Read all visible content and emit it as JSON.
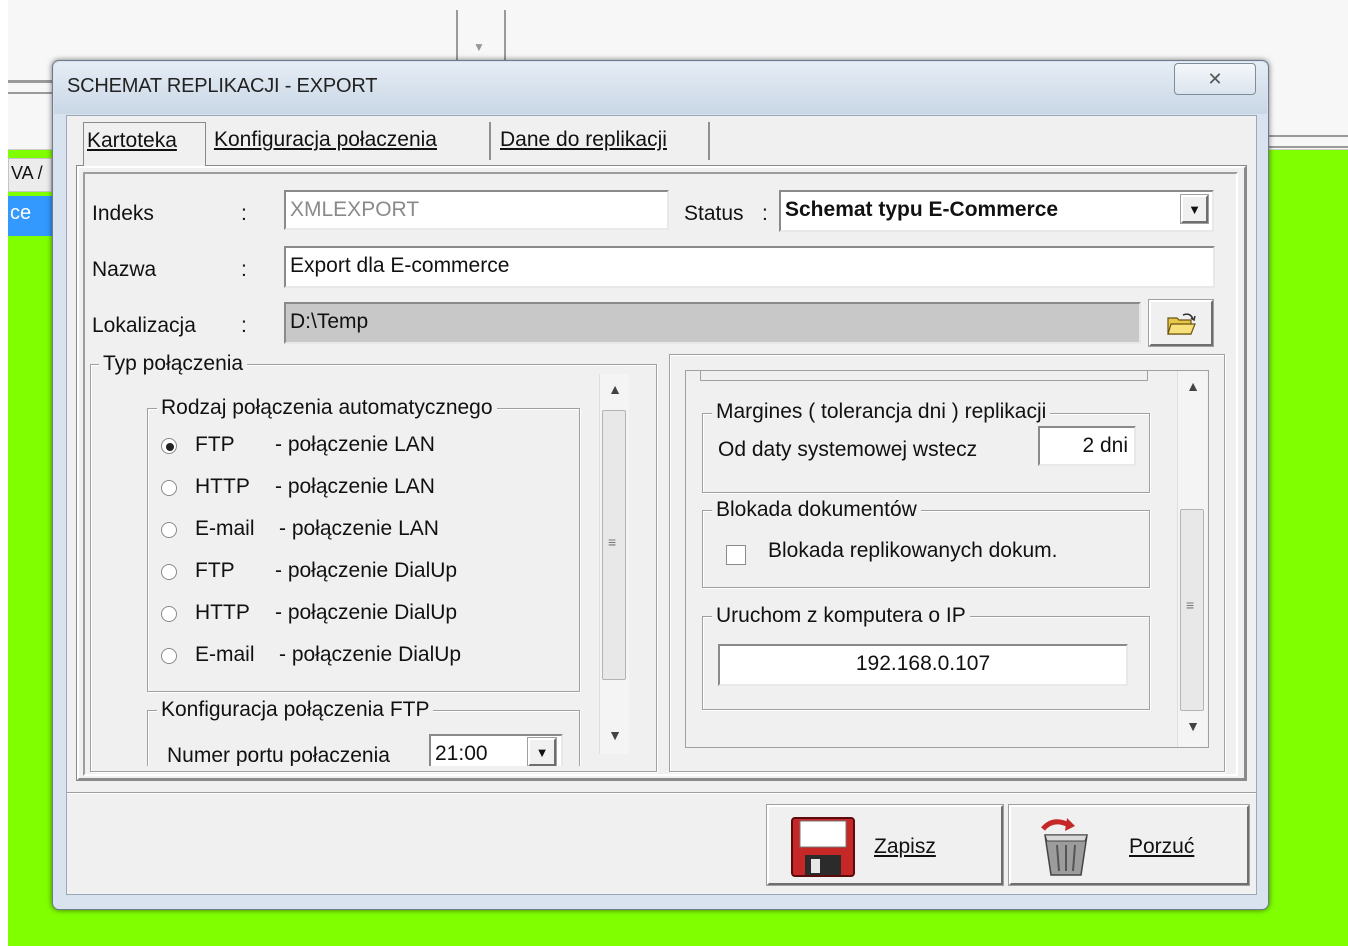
{
  "background": {
    "column_label": "VA /",
    "selected_cell": "ce",
    "accent_color": "#80ff00"
  },
  "dialog": {
    "title": "SCHEMAT REPLIKACJI - EXPORT",
    "close_icon": "close-icon",
    "tabs": [
      {
        "label": "Kartoteka",
        "active": true
      },
      {
        "label": "Konfiguracja połaczenia",
        "active": false
      },
      {
        "label": "Dane do replikacji",
        "active": false
      }
    ],
    "fields": {
      "indeks_label": "Indeks",
      "indeks_sep": ":",
      "indeks_value": "XMLEXPORT",
      "status_label": "Status",
      "status_sep": ":",
      "status_value": "Schemat typu E-Commerce",
      "nazwa_label": "Nazwa",
      "nazwa_sep": ":",
      "nazwa_value": "Export dla E-commerce",
      "lokalizacja_label": "Lokalizacja",
      "lokalizacja_sep": ":",
      "lokalizacja_value": "D:\\Temp"
    },
    "typ_polaczenia": {
      "title": "Typ połączenia",
      "rodzaj": {
        "title": "Rodzaj połączenia automatycznego",
        "options": [
          {
            "proto": "FTP",
            "desc": "- połączenie LAN",
            "selected": true
          },
          {
            "proto": "HTTP",
            "desc": "- połączenie LAN",
            "selected": false
          },
          {
            "proto": "E-mail",
            "desc": "- połączenie LAN",
            "selected": false
          },
          {
            "proto": "FTP",
            "desc": "- połączenie DialUp",
            "selected": false
          },
          {
            "proto": "HTTP",
            "desc": "- połączenie DialUp",
            "selected": false
          },
          {
            "proto": "E-mail",
            "desc": "- połączenie DialUp",
            "selected": false
          }
        ]
      },
      "ftp": {
        "title": "Konfiguracja połączenia FTP",
        "port_label": "Numer portu połaczenia",
        "port_value": "21:00"
      }
    },
    "right_panel": {
      "margines": {
        "title": "Margines ( tolerancja dni ) replikacji",
        "label": "Od daty systemowej  wstecz",
        "value": "2 dni"
      },
      "blokada": {
        "title": "Blokada dokumentów",
        "checkbox_label": "Blokada replikowanych dokum.",
        "checked": false
      },
      "uruchom": {
        "title": "Uruchom z komputera o IP",
        "ip": "192.168.0.107"
      }
    },
    "buttons": {
      "save": "Zapisz",
      "cancel": "Porzuć"
    }
  }
}
